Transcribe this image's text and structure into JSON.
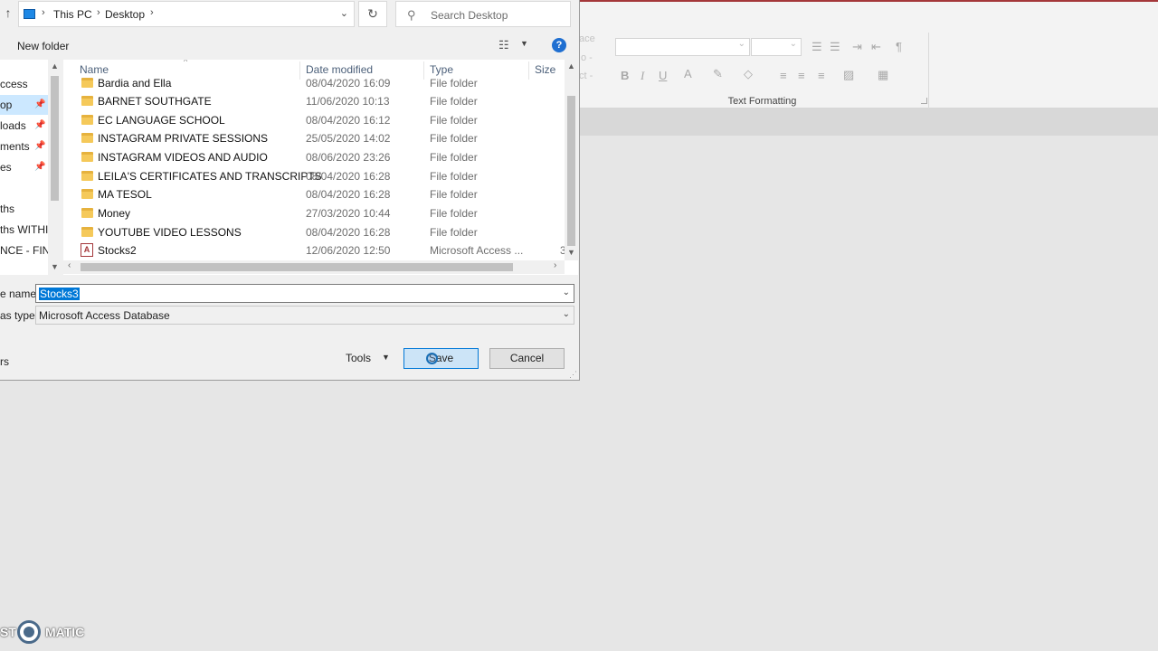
{
  "address_bar": {
    "crumbs": [
      "This PC",
      "Desktop"
    ],
    "search_placeholder": "Search Desktop"
  },
  "toolbar": {
    "new_folder": "New folder",
    "help": "?"
  },
  "nav_pane": {
    "items": [
      {
        "label": "ccess",
        "pinned": false
      },
      {
        "label": "op",
        "pinned": true,
        "selected": true
      },
      {
        "label": "loads",
        "pinned": true
      },
      {
        "label": "ments",
        "pinned": true
      },
      {
        "label": "es",
        "pinned": true
      },
      {
        "label": "ths",
        "pinned": false
      },
      {
        "label": "ths WITHIN",
        "pinned": false
      },
      {
        "label": "NCE - FINA",
        "pinned": false
      }
    ]
  },
  "file_list": {
    "columns": [
      "Name",
      "Date modified",
      "Type",
      "Size"
    ],
    "rows": [
      {
        "name": "Bardia and Ella",
        "date": "08/04/2020 16:09",
        "type": "File folder",
        "size": "",
        "kind": "folder"
      },
      {
        "name": "BARNET SOUTHGATE",
        "date": "11/06/2020 10:13",
        "type": "File folder",
        "size": "",
        "kind": "folder"
      },
      {
        "name": "EC LANGUAGE SCHOOL",
        "date": "08/04/2020 16:12",
        "type": "File folder",
        "size": "",
        "kind": "folder"
      },
      {
        "name": "INSTAGRAM PRIVATE SESSIONS",
        "date": "25/05/2020 14:02",
        "type": "File folder",
        "size": "",
        "kind": "folder"
      },
      {
        "name": "INSTAGRAM VIDEOS AND AUDIO",
        "date": "08/06/2020 23:26",
        "type": "File folder",
        "size": "",
        "kind": "folder"
      },
      {
        "name": "LEILA'S CERTIFICATES AND TRANSCRIPTS",
        "date": "08/04/2020 16:28",
        "type": "File folder",
        "size": "",
        "kind": "folder"
      },
      {
        "name": "MA TESOL",
        "date": "08/04/2020 16:28",
        "type": "File folder",
        "size": "",
        "kind": "folder"
      },
      {
        "name": "Money",
        "date": "27/03/2020 10:44",
        "type": "File folder",
        "size": "",
        "kind": "folder"
      },
      {
        "name": "YOUTUBE VIDEO LESSONS",
        "date": "08/04/2020 16:28",
        "type": "File folder",
        "size": "",
        "kind": "folder"
      },
      {
        "name": "Stocks2",
        "date": "12/06/2020 12:50",
        "type": "Microsoft Access ...",
        "size": "3",
        "kind": "access"
      }
    ]
  },
  "save_form": {
    "file_name_label": "e name:",
    "file_name_value": "Stocks3",
    "save_type_label": "as type:",
    "save_type_value": "Microsoft Access Database",
    "hide_folders": "rs",
    "tools": "Tools",
    "save": "Save",
    "cancel": "Cancel"
  },
  "ribbon": {
    "group_label": "Text Formatting",
    "dim_labels": [
      "ace",
      "o -",
      "ct -"
    ]
  },
  "watermark": {
    "left": "ST",
    "right": "MATIC"
  },
  "colors": {
    "access_brand": "#a4373a",
    "selection": "#0078d7",
    "nav_selected": "#cce8ff"
  }
}
